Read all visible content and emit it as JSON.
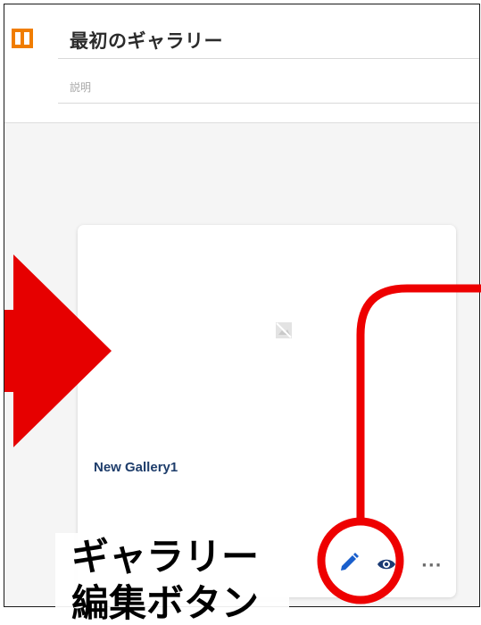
{
  "header": {
    "title": "最初のギャラリー",
    "description_placeholder": "説明"
  },
  "gallery_card": {
    "name": "New Gallery1",
    "thumbnail_icon": "broken-image-icon",
    "actions": {
      "edit_icon": "pencil-icon",
      "view_icon": "eye-icon",
      "more_label": "···"
    }
  },
  "annotation": {
    "line1": "ギャラリー",
    "line2": "編集ボタン"
  },
  "colors": {
    "logo": "#f07d00",
    "highlight": "#ee0000",
    "gallery_name": "#1e3d6b",
    "edit_icon": "#1a5fcc"
  }
}
